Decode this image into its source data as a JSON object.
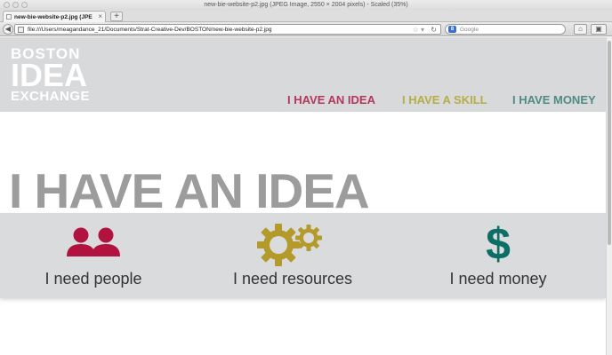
{
  "window": {
    "title": "new-bie-website-p2.jpg (JPEG Image, 2550 × 2004 pixels) - Scaled (35%)"
  },
  "tabs": [
    {
      "label": "new-bie-website-p2.jpg (JPEG I..."
    }
  ],
  "new_tab_label": "+",
  "address_bar": {
    "url": "file:///Users/meagandance_21/Documents/Strat-Creative-Dev/BOSTON/new-bie-website-p2.jpg"
  },
  "search_bar": {
    "engine_letter": "8",
    "placeholder": "Google"
  },
  "site": {
    "logo": {
      "line1": "BOSTON",
      "line2": "IDEA",
      "line3": "EXCHANGE"
    },
    "nav": {
      "idea": "I HAVE AN IDEA",
      "skill": "I HAVE A SKILL",
      "money": "I HAVE MONEY"
    },
    "hero_title": "I HAVE AN IDEA",
    "needs": [
      {
        "label": "I need people",
        "icon": "people-icon"
      },
      {
        "label": "I need resources",
        "icon": "gears-icon"
      },
      {
        "label": "I need money",
        "icon": "dollar-icon"
      }
    ]
  },
  "colors": {
    "header_bg": "#d8d9da",
    "idea": "#b5365c",
    "skill": "#b7ad46",
    "money": "#4f8b83",
    "people_icon": "#b2123f",
    "gears_icon": "#b39a2a",
    "dollar_icon": "#0d6e66"
  }
}
